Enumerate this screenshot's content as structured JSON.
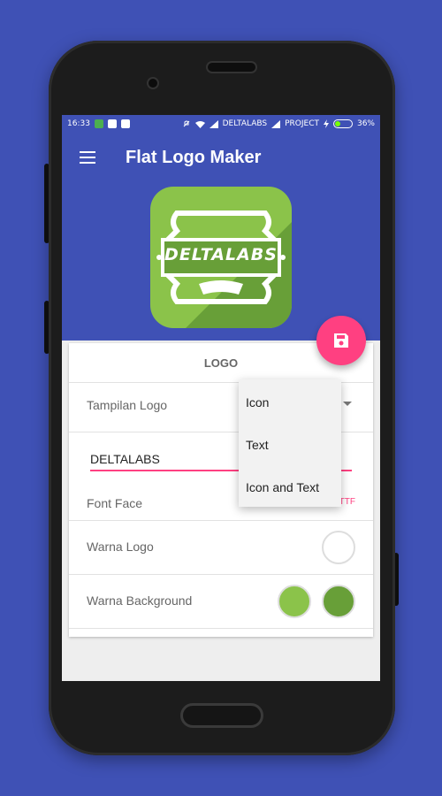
{
  "status_bar": {
    "time": "16:33",
    "carrier1": "DELTALABS",
    "carrier2": "PROJECT",
    "battery": "36%",
    "battery_level": 0.36
  },
  "app_bar": {
    "title": "Flat Logo Maker",
    "menu_icon": "hamburger-menu-icon"
  },
  "logo_preview": {
    "text": "DELTALABS",
    "background_color": "#8bc34a",
    "shadow_color": "#689f38",
    "emblem_color": "#ffffff",
    "ribbon_color": "#689f38"
  },
  "fab": {
    "icon": "save-icon",
    "color": "#ff4081"
  },
  "card": {
    "title": "LOGO",
    "display_label": "Tampilan Logo",
    "text_value": "DELTALABS",
    "font_face_label": "Font Face",
    "font_face_value": "..LTTF",
    "logo_color_label": "Warna Logo",
    "logo_color": "#ffffff",
    "background_color_label": "Warna Background",
    "background_colors": [
      "#8bc34a",
      "#689f38"
    ]
  },
  "popup_menu": {
    "items": [
      "Icon",
      "Text",
      "Icon and Text"
    ]
  },
  "colors": {
    "primary": "#3f51b5",
    "accent": "#ff4081"
  }
}
